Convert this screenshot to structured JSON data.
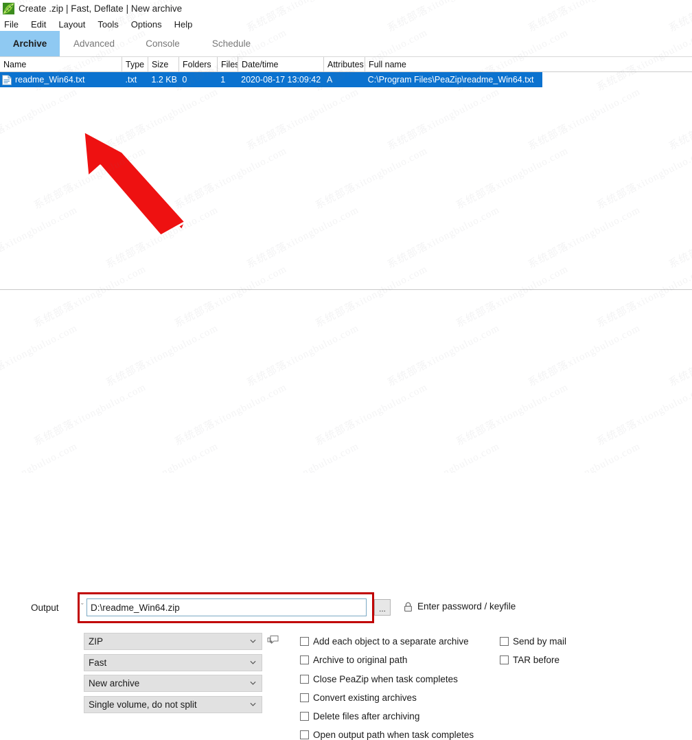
{
  "window": {
    "title": "Create .zip | Fast, Deflate | New archive",
    "app_icon": "peazip-pea-icon"
  },
  "menubar": {
    "items": [
      {
        "label": "File"
      },
      {
        "label": "Edit"
      },
      {
        "label": "Layout"
      },
      {
        "label": "Tools"
      },
      {
        "label": "Options"
      },
      {
        "label": "Help"
      }
    ]
  },
  "tabs": [
    {
      "label": "Archive",
      "active": true
    },
    {
      "label": "Advanced",
      "active": false
    },
    {
      "label": "Console",
      "active": false
    },
    {
      "label": "Schedule",
      "active": false
    }
  ],
  "filelist": {
    "columns": [
      {
        "label": "Name"
      },
      {
        "label": "Type"
      },
      {
        "label": "Size"
      },
      {
        "label": "Folders"
      },
      {
        "label": "Files"
      },
      {
        "label": "Date/time"
      },
      {
        "label": "Attributes"
      },
      {
        "label": "Full name"
      }
    ],
    "rows": [
      {
        "icon": "text-file-icon",
        "name": "readme_Win64.txt",
        "type": ".txt",
        "size": "1.2 KB",
        "folders": "0",
        "files": "1",
        "datetime": "2020-08-17 13:09:42",
        "attributes": "A",
        "fullname": "C:\\Program Files\\PeaZip\\readme_Win64.txt",
        "selected": true
      }
    ]
  },
  "output": {
    "label": "Output",
    "value": "D:\\readme_Win64.zip",
    "placeholder": "",
    "browse_label": "...",
    "password_label": "Enter password / keyfile",
    "lock_icon": "padlock-icon",
    "chevron": "ˇ"
  },
  "dropdowns": [
    {
      "name": "format",
      "value": "ZIP"
    },
    {
      "name": "compression-level",
      "value": "Fast"
    },
    {
      "name": "archive-mode",
      "value": "New archive"
    },
    {
      "name": "volume-split",
      "value": "Single volume, do not split"
    }
  ],
  "comment_icon": "speech-bubble-icon",
  "checkboxes_left": [
    {
      "label": "Add each object to a separate archive",
      "checked": false
    },
    {
      "label": "Archive to original path",
      "checked": false
    },
    {
      "label": "Close PeaZip when task completes",
      "checked": false
    },
    {
      "label": "Convert existing archives",
      "checked": false
    },
    {
      "label": "Delete files after archiving",
      "checked": false
    },
    {
      "label": "Open output path when task completes",
      "checked": false
    }
  ],
  "checkboxes_right": [
    {
      "label": "Send by mail",
      "checked": false
    },
    {
      "label": "TAR before",
      "checked": false
    }
  ],
  "annotations": {
    "arrow": "red-arrow-pointing-to-file-row",
    "highlight_box": "red-rectangle-around-output-field"
  },
  "watermark": {
    "text": "系统部落xitongbuluo.com"
  },
  "colors": {
    "selection_blue": "#0b72cf",
    "tab_active_blue": "#8fc9f2",
    "annotation_red": "#c00000",
    "dropdown_grey": "#e1e1e1"
  }
}
